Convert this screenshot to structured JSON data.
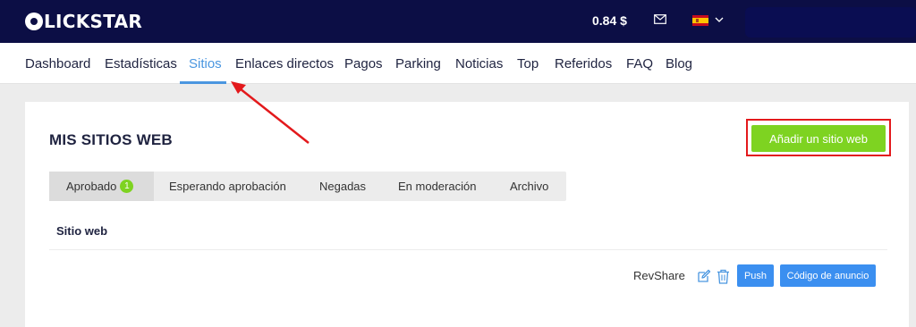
{
  "header": {
    "logo_text": "LICKSTAR",
    "balance": "0.84 $",
    "language_flag": "es"
  },
  "nav": {
    "items": [
      {
        "label": "Dashboard"
      },
      {
        "label": "Estadísticas"
      },
      {
        "label": "Sitios"
      },
      {
        "label": "Enlaces directos"
      },
      {
        "label": "Pagos"
      },
      {
        "label": "Parking"
      },
      {
        "label": "Noticias"
      },
      {
        "label": "Top"
      },
      {
        "label": "Referidos"
      },
      {
        "label": "FAQ"
      },
      {
        "label": "Blog"
      }
    ],
    "active": "Sitios"
  },
  "page": {
    "title": "MIS SITIOS WEB",
    "add_button": "Añadir un sitio web"
  },
  "tabs": [
    {
      "label": "Aprobado",
      "badge": "1"
    },
    {
      "label": "Esperando aprobación"
    },
    {
      "label": "Negadas"
    },
    {
      "label": "En moderación"
    },
    {
      "label": "Archivo"
    }
  ],
  "table": {
    "column_header": "Sitio web",
    "row": {
      "revshare_label": "RevShare",
      "push_label": "Push",
      "code_label": "Código de anuncio"
    }
  },
  "colors": {
    "topbar": "#0c0e45",
    "accent_blue": "#4a96e0",
    "button_green": "#7ed321",
    "button_blue": "#3b8ff0",
    "annotation_red": "#e3191c"
  }
}
